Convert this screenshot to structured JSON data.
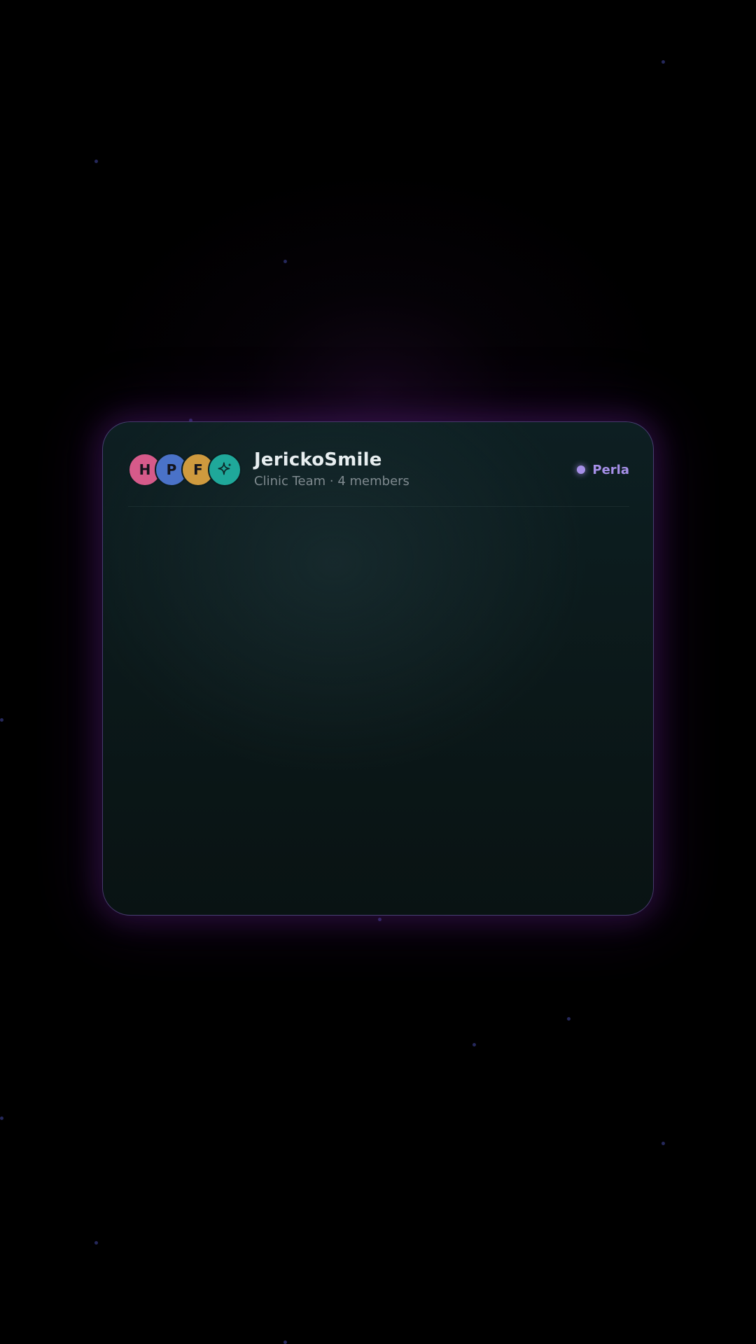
{
  "group": {
    "name": "JerickoSmile",
    "subtitle": "Clinic Team · 4 members"
  },
  "members": [
    {
      "initial": "H",
      "color": "#d65a8a"
    },
    {
      "initial": "P",
      "color": "#4a72c8"
    },
    {
      "initial": "F",
      "color": "#cf9a3e"
    },
    {
      "initial": "",
      "icon": "sparkle-icon",
      "color": "#1fa89a"
    }
  ],
  "presence": {
    "name": "Perla",
    "color": "#a690e8"
  },
  "theme": {
    "background": "#000000",
    "card": "#0c1c1e",
    "glow": "#7a2aa8"
  }
}
